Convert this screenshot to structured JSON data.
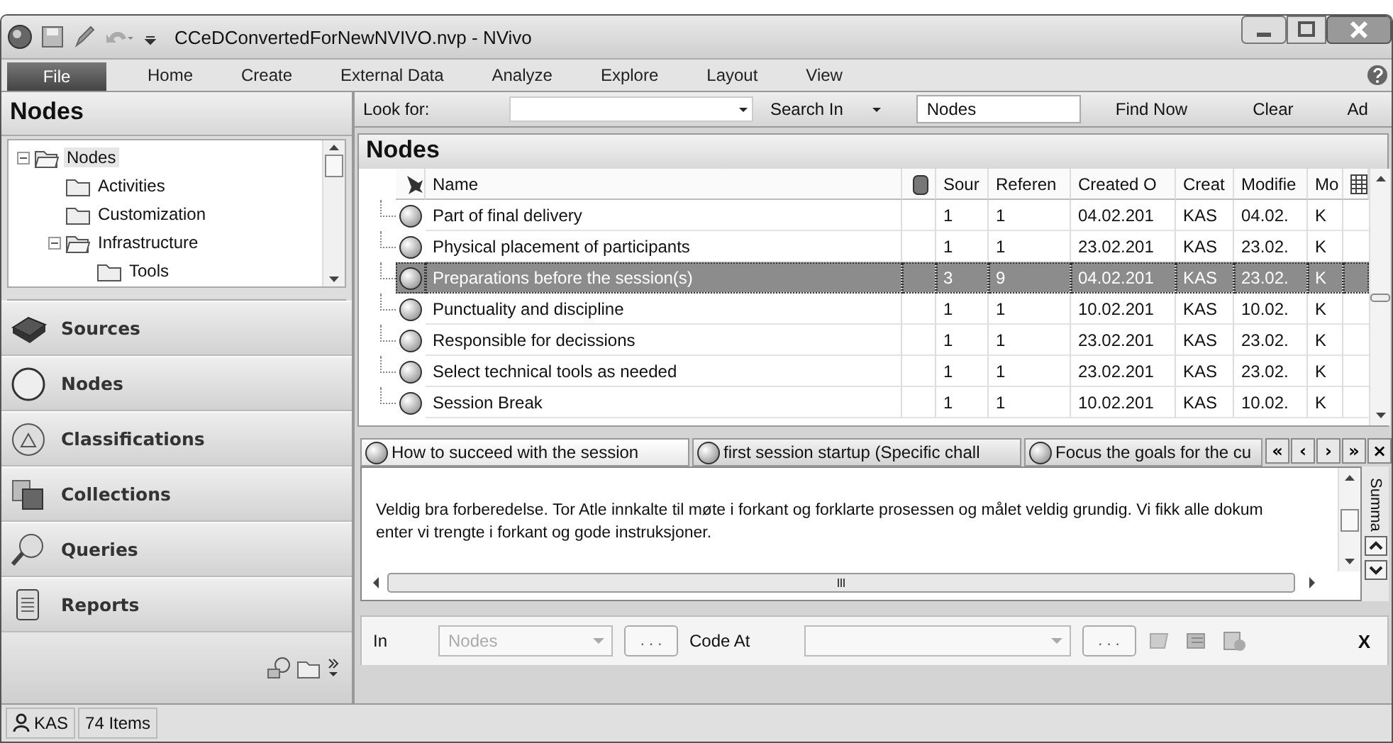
{
  "window": {
    "title": "CCeDConvertedForNewNVIVO.nvp - NVivo"
  },
  "file_button": "File",
  "ribbon_tabs": [
    "Home",
    "Create",
    "External Data",
    "Analyze",
    "Explore",
    "Layout",
    "View"
  ],
  "navigation": {
    "title": "Nodes",
    "tree": [
      {
        "label": "Nodes",
        "selected": true,
        "expanded": true,
        "children": [
          {
            "label": "Activities",
            "selected": false
          },
          {
            "label": "Customization",
            "selected": false
          },
          {
            "label": "Infrastructure",
            "selected": false,
            "expanded": true,
            "children": [
              {
                "label": "Tools",
                "selected": false
              }
            ]
          }
        ]
      }
    ],
    "sections": [
      "Sources",
      "Nodes",
      "Classifications",
      "Collections",
      "Queries",
      "Reports"
    ]
  },
  "find_bar": {
    "look_for_label": "Look for:",
    "search_in_label": "Search In",
    "search_in_value": "Nodes",
    "find_now": "Find Now",
    "clear": "Clear",
    "advanced": "Ad"
  },
  "list": {
    "title": "Nodes",
    "columns": [
      "Name",
      "Sour",
      "Referen",
      "Created O",
      "Creat",
      "Modifie",
      "Mo"
    ],
    "rows": [
      {
        "cells": [
          "Part of final delivery",
          "1",
          "1",
          "04.02.201",
          "KAS",
          "04.02.",
          "K"
        ],
        "selected": false
      },
      {
        "cells": [
          "Physical placement of participants",
          "1",
          "1",
          "23.02.201",
          "KAS",
          "23.02.",
          "K"
        ],
        "selected": false
      },
      {
        "cells": [
          "Preparations before the session(s)",
          "3",
          "9",
          "04.02.201",
          "KAS",
          "23.02.",
          "K"
        ],
        "selected": true
      },
      {
        "cells": [
          "Punctuality and discipline",
          "1",
          "1",
          "10.02.201",
          "KAS",
          "10.02.",
          "K"
        ],
        "selected": false
      },
      {
        "cells": [
          "Responsible for decissions",
          "1",
          "1",
          "23.02.201",
          "KAS",
          "23.02.",
          "K"
        ],
        "selected": false
      },
      {
        "cells": [
          "Select technical tools as needed",
          "1",
          "1",
          "23.02.201",
          "KAS",
          "23.02.",
          "K"
        ],
        "selected": false
      },
      {
        "cells": [
          "Session Break",
          "1",
          "1",
          "10.02.201",
          "KAS",
          "10.02.",
          "K"
        ],
        "selected": false
      }
    ]
  },
  "detail_tabs": [
    {
      "label": "How to succeed with the session",
      "selected": true
    },
    {
      "label": "first session startup (Specific chall",
      "selected": false
    },
    {
      "label": "Focus the goals for the cu",
      "selected": false
    }
  ],
  "detail_nav": [
    "«",
    "‹",
    "›",
    "»",
    "×"
  ],
  "detail": {
    "text": "Veldig bra forberedelse. Tor Atle innkalte til møte i forkant og forklarte prosessen og målet veldig grundig. Vi fikk alle dokum enter vi trengte i forkant og gode instruksjoner.",
    "side_label": "Summa"
  },
  "code_bar": {
    "in_label": "In",
    "in_value": "Nodes",
    "browse": ". . .",
    "code_at_label": "Code At",
    "browse_2": ". . .",
    "close": "X"
  },
  "status_bar": {
    "user": "KAS",
    "count": "74 Items"
  }
}
